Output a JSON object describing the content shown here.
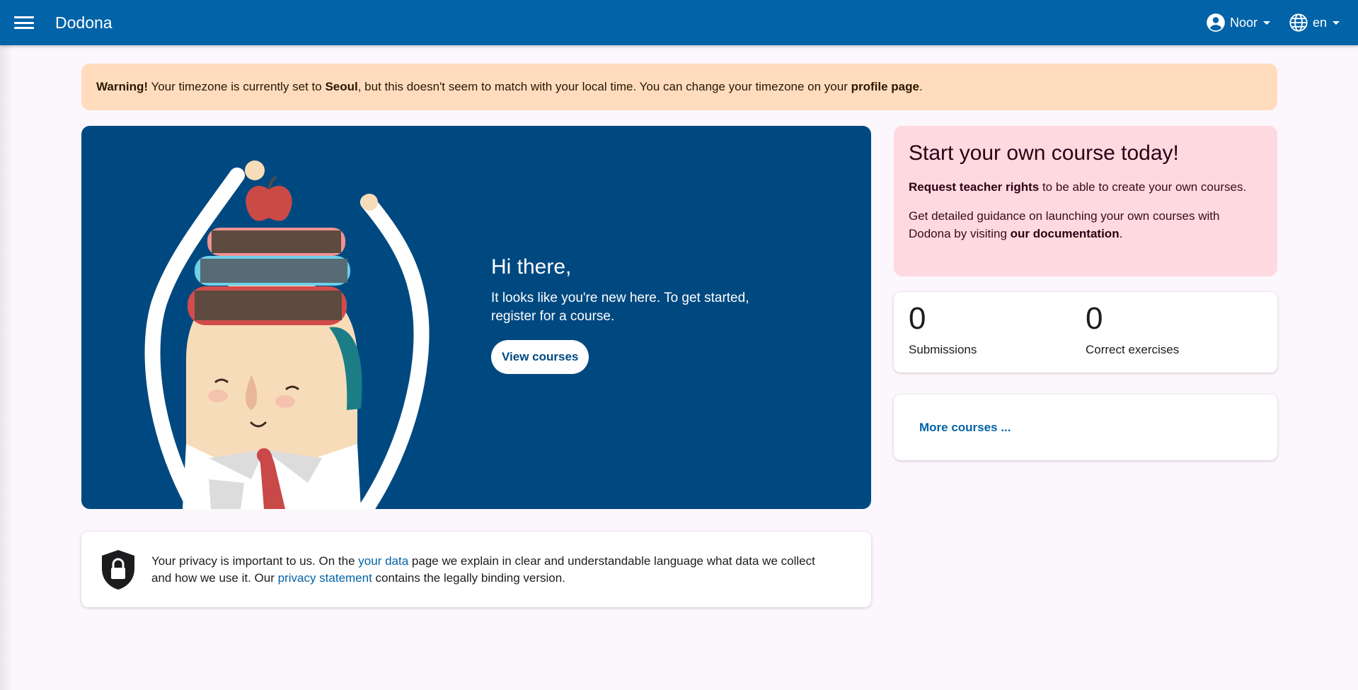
{
  "topbar": {
    "brand": "Dodona",
    "user_name": "Noor",
    "language": "en"
  },
  "warning": {
    "label": "Warning!",
    "text_1": " Your timezone is currently set to ",
    "timezone": "Seoul",
    "text_2": ", but this doesn't seem to match with your local time. You can change your timezone on your ",
    "link": "profile page",
    "text_3": "."
  },
  "hero": {
    "title": "Hi there,",
    "subtitle": "It looks like you're new here. To get started, register for a course.",
    "button": "View courses"
  },
  "privacy": {
    "text_1": "Your privacy is important to us. On the ",
    "link_1": "your data",
    "text_2": " page we explain in clear and understandable language what data we collect and how we use it. Our ",
    "link_2": "privacy statement",
    "text_3": " contains the legally binding version."
  },
  "teacher": {
    "title": "Start your own course today!",
    "p1_bold": "Request teacher rights",
    "p1_rest": " to be able to create your own courses.",
    "p2_text": "Get detailed guidance on launching your own courses with Dodona by visiting ",
    "p2_bold": "our documentation",
    "p2_end": "."
  },
  "stats": [
    {
      "value": "0",
      "label": "Submissions"
    },
    {
      "value": "0",
      "label": "Correct exercises"
    }
  ],
  "more_courses": "More courses ...",
  "colors": {
    "topbar": "#0263a8",
    "hero": "#004980",
    "warning_bg": "#ffdcbe",
    "teacher_bg": "#ffd9e0",
    "link": "#0263a8"
  },
  "icons": [
    "menu-icon",
    "account-circle-icon",
    "globe-icon",
    "shield-lock-icon"
  ]
}
